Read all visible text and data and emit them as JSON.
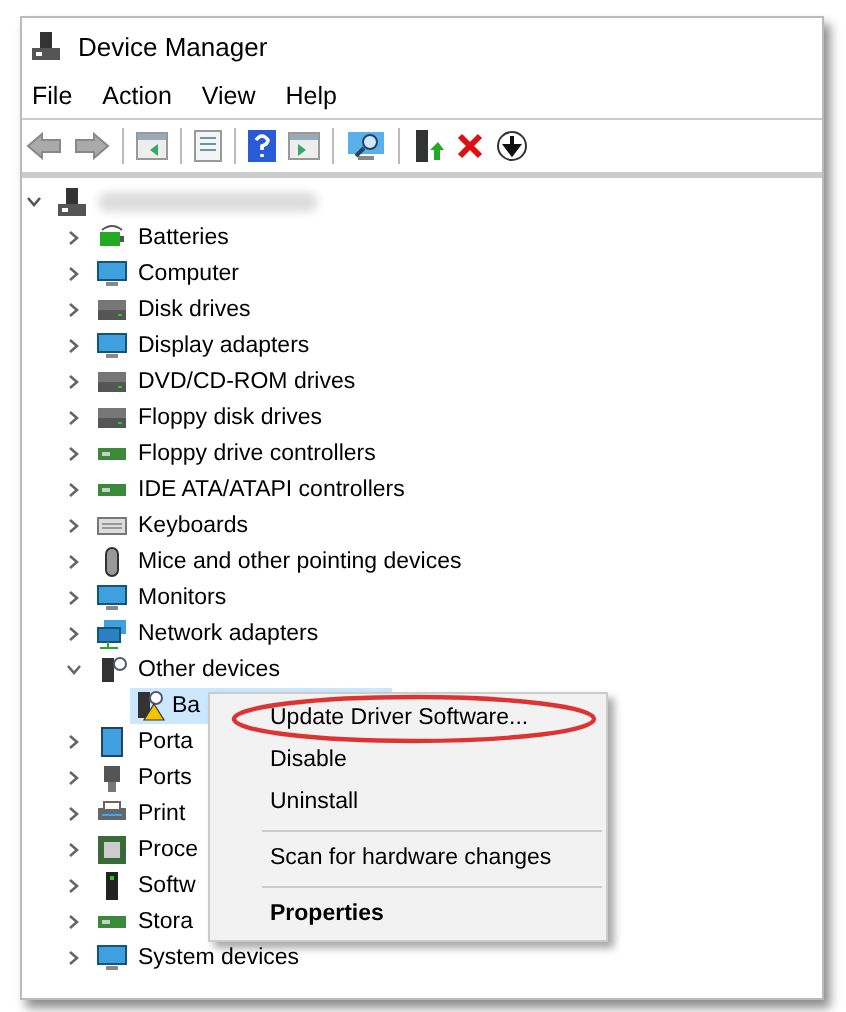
{
  "window": {
    "title": "Device Manager"
  },
  "menu_bar": [
    "File",
    "Action",
    "View",
    "Help"
  ],
  "tree": {
    "root": {
      "expanded": true,
      "children": [
        {
          "label": "Batteries",
          "expanded": false,
          "selected": false
        },
        {
          "label": "Computer",
          "expanded": false,
          "selected": false
        },
        {
          "label": "Disk drives",
          "expanded": false,
          "selected": false
        },
        {
          "label": "Display adapters",
          "expanded": false,
          "selected": false
        },
        {
          "label": "DVD/CD-ROM drives",
          "expanded": false,
          "selected": false
        },
        {
          "label": "Floppy disk drives",
          "expanded": false,
          "selected": false
        },
        {
          "label": "Floppy drive controllers",
          "expanded": false,
          "selected": false
        },
        {
          "label": "IDE ATA/ATAPI controllers",
          "expanded": false,
          "selected": false
        },
        {
          "label": "Keyboards",
          "expanded": false,
          "selected": false
        },
        {
          "label": "Mice and other pointing devices",
          "expanded": false,
          "selected": false
        },
        {
          "label": "Monitors",
          "expanded": false,
          "selected": false
        },
        {
          "label": "Network adapters",
          "expanded": false,
          "selected": false
        },
        {
          "label": "Other devices",
          "expanded": true,
          "selected": false,
          "children": [
            {
              "label": "Ba",
              "selected": true,
              "warning": true
            }
          ]
        },
        {
          "label": "Porta",
          "expanded": false,
          "selected": false
        },
        {
          "label": "Ports",
          "expanded": false,
          "selected": false
        },
        {
          "label": "Print",
          "expanded": false,
          "selected": false
        },
        {
          "label": "Proce",
          "expanded": false,
          "selected": false
        },
        {
          "label": "Softw",
          "expanded": false,
          "selected": false
        },
        {
          "label": "Stora",
          "expanded": false,
          "selected": false
        },
        {
          "label": "System devices",
          "expanded": false,
          "selected": false
        }
      ]
    }
  },
  "context_menu": [
    {
      "label": "Update Driver Software...",
      "circled": true,
      "default": false,
      "separator_after": false
    },
    {
      "label": "Disable",
      "circled": false,
      "default": false,
      "separator_after": false
    },
    {
      "label": "Uninstall",
      "circled": false,
      "default": false,
      "separator_after": true
    },
    {
      "label": "Scan for hardware changes",
      "circled": false,
      "default": false,
      "separator_after": true
    },
    {
      "label": "Properties",
      "circled": false,
      "default": true,
      "separator_after": false
    }
  ]
}
